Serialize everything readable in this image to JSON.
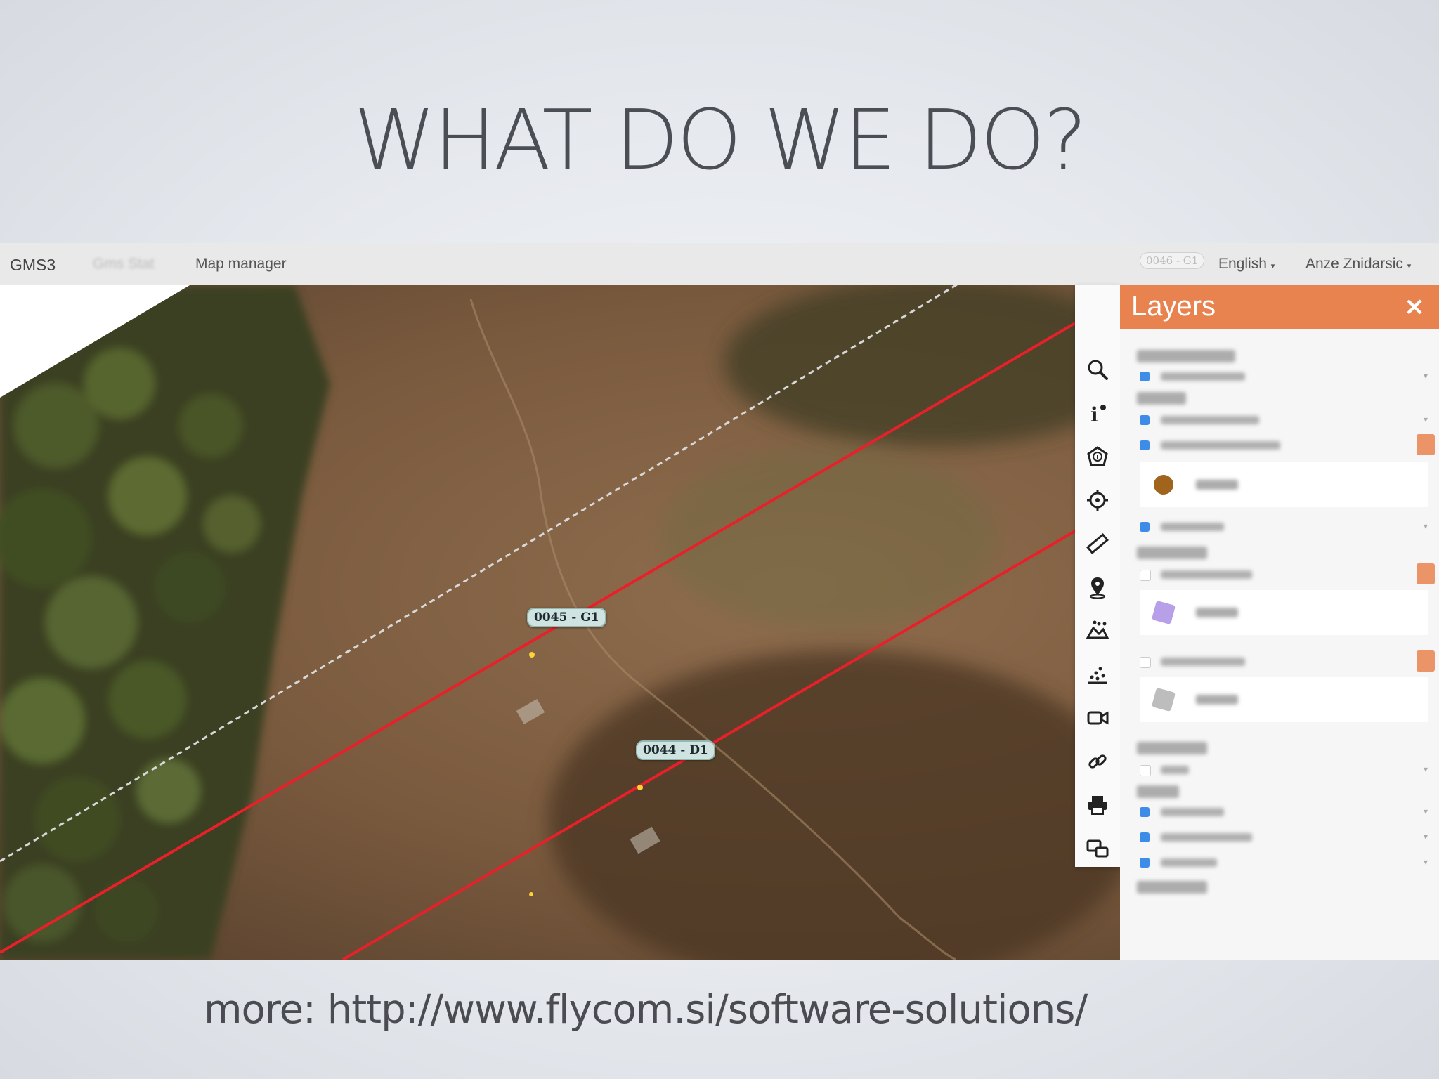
{
  "slide": {
    "title": "WHAT DO WE DO?",
    "footer": "more: http://www.flycom.si/software-solutions/"
  },
  "app": {
    "brand": "GMS3",
    "menu_blurred": "Gms Stat",
    "map_manager": "Map manager",
    "selected_tower": "0046 - G1",
    "language": "English",
    "user": "Anze Znidarsic"
  },
  "map": {
    "tower_labels": [
      "0045 - G1",
      "0044 - D1"
    ],
    "line_color": "#e8202a",
    "boundary_color": "#d8d8d8"
  },
  "toolbar": {
    "tools": [
      "layers-icon",
      "search-icon",
      "info-icon",
      "feature-info-icon",
      "locate-icon",
      "measure-ruler-icon",
      "place-marker-icon",
      "vegetation-icon",
      "scatter-points-icon",
      "video-icon",
      "link-icon",
      "print-icon",
      "compare-icon"
    ]
  },
  "layers_panel": {
    "title": "Layers",
    "close": "×",
    "accent_color": "#e8834f",
    "groups": [
      "World Borders",
      "Towers",
      "Vegetation",
      "Lidar Data",
      "Spans",
      "Video Beat"
    ],
    "default_label": "Default"
  }
}
